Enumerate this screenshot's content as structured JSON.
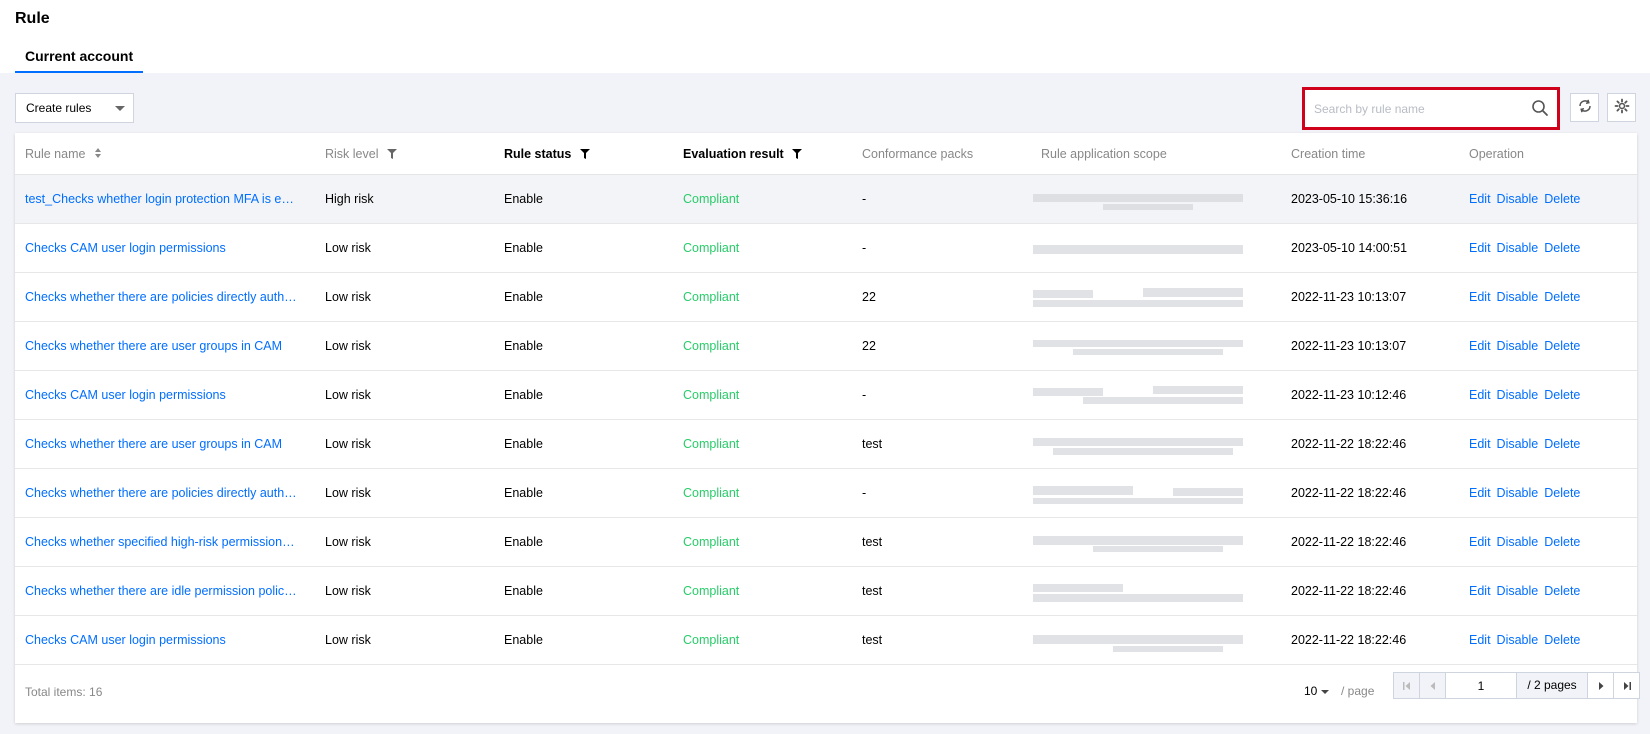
{
  "page": {
    "title": "Rule"
  },
  "tabs": [
    {
      "label": "Current account",
      "active": true
    }
  ],
  "toolbar": {
    "create_label": "Create rules",
    "search_placeholder": "Search by rule name",
    "search_value": ""
  },
  "table": {
    "columns": {
      "rule_name": "Rule name",
      "risk_level": "Risk level",
      "rule_status": "Rule status",
      "evaluation_result": "Evaluation result",
      "conformance_packs": "Conformance packs",
      "scope": "Rule application scope",
      "creation_time": "Creation time",
      "operation": "Operation"
    },
    "ops": {
      "edit": "Edit",
      "disable": "Disable",
      "delete": "Delete"
    },
    "rows": [
      {
        "name": "test_Checks whether login protection MFA is enabl...",
        "risk": "High risk",
        "status": "Enable",
        "result": "Compliant",
        "packs": "-",
        "time": "2023-05-10 15:36:16"
      },
      {
        "name": "Checks CAM user login permissions",
        "risk": "Low risk",
        "status": "Enable",
        "result": "Compliant",
        "packs": "-",
        "time": "2023-05-10 14:00:51"
      },
      {
        "name": "Checks whether there are policies directly authoriz...",
        "risk": "Low risk",
        "status": "Enable",
        "result": "Compliant",
        "packs": "22",
        "time": "2022-11-23 10:13:07"
      },
      {
        "name": "Checks whether there are user groups in CAM",
        "risk": "Low risk",
        "status": "Enable",
        "result": "Compliant",
        "packs": "22",
        "time": "2022-11-23 10:13:07"
      },
      {
        "name": "Checks CAM user login permissions",
        "risk": "Low risk",
        "status": "Enable",
        "result": "Compliant",
        "packs": "-",
        "time": "2022-11-23 10:12:46"
      },
      {
        "name": "Checks whether there are user groups in CAM",
        "risk": "Low risk",
        "status": "Enable",
        "result": "Compliant",
        "packs": "test",
        "time": "2022-11-22 18:22:46"
      },
      {
        "name": "Checks whether there are policies directly authoriz...",
        "risk": "Low risk",
        "status": "Enable",
        "result": "Compliant",
        "packs": "-",
        "time": "2022-11-22 18:22:46"
      },
      {
        "name": "Checks whether specified high-risk permission is a...",
        "risk": "Low risk",
        "status": "Enable",
        "result": "Compliant",
        "packs": "test",
        "time": "2022-11-22 18:22:46"
      },
      {
        "name": "Checks whether there are idle permission policies i...",
        "risk": "Low risk",
        "status": "Enable",
        "result": "Compliant",
        "packs": "test",
        "time": "2022-11-22 18:22:46"
      },
      {
        "name": "Checks CAM user login permissions",
        "risk": "Low risk",
        "status": "Enable",
        "result": "Compliant",
        "packs": "test",
        "time": "2022-11-22 18:22:46"
      }
    ]
  },
  "footer": {
    "total_label": "Total items:",
    "total_value": "16",
    "page_size": "10",
    "per_page_label": "/ page",
    "current_page": "1",
    "total_pages_label": "/ 2 pages"
  },
  "colors": {
    "accent": "#006eff",
    "compliant": "#29cc6a",
    "highlight": "#d0021b"
  }
}
